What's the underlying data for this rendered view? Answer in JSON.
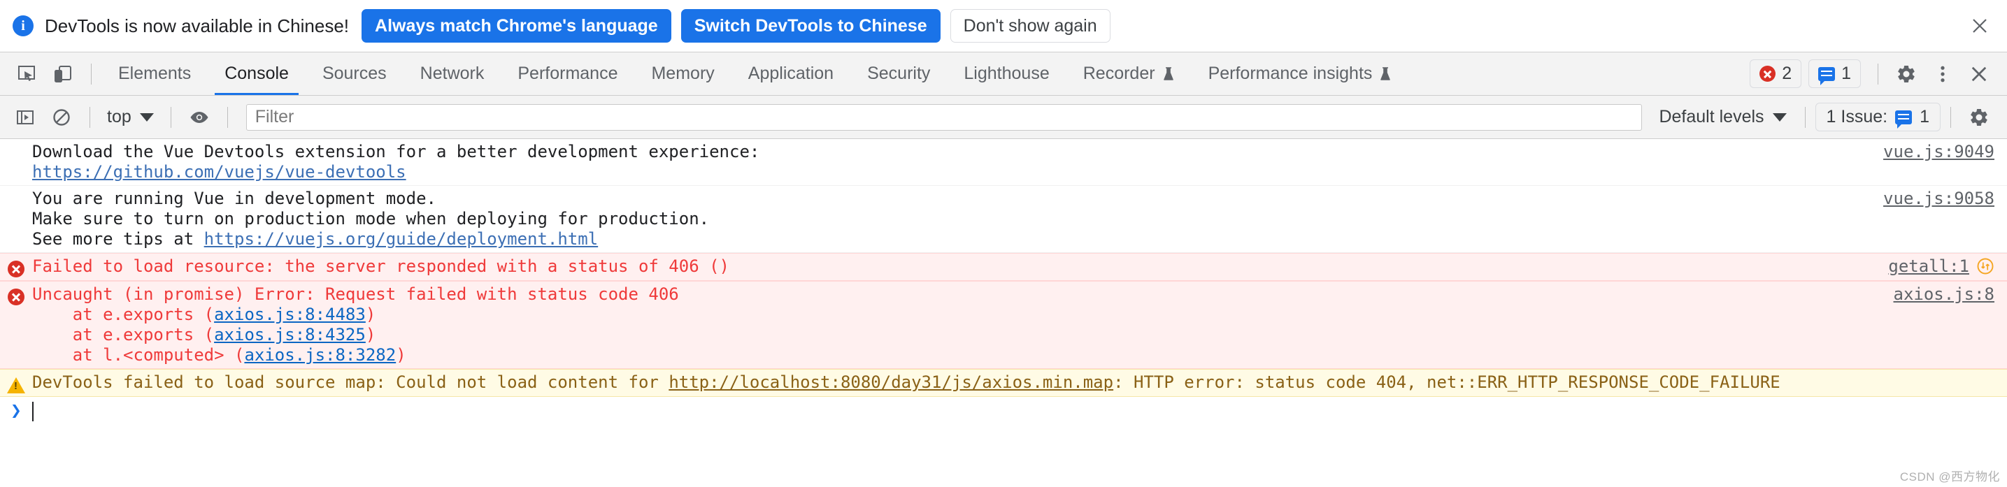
{
  "infobar": {
    "icon": "info-icon",
    "message": "DevTools is now available in Chinese!",
    "primary_button_1": "Always match Chrome's language",
    "primary_button_2": "Switch DevTools to Chinese",
    "secondary_button": "Don't show again",
    "close_icon": "close-icon",
    "accent_color": "#1a73e8"
  },
  "tabstrip": {
    "inspect_icon": "inspect-element-icon",
    "device_icon": "device-toolbar-icon",
    "tabs": [
      {
        "label": "Elements",
        "selected": false,
        "experimental": false
      },
      {
        "label": "Console",
        "selected": true,
        "experimental": false
      },
      {
        "label": "Sources",
        "selected": false,
        "experimental": false
      },
      {
        "label": "Network",
        "selected": false,
        "experimental": false
      },
      {
        "label": "Performance",
        "selected": false,
        "experimental": false
      },
      {
        "label": "Memory",
        "selected": false,
        "experimental": false
      },
      {
        "label": "Application",
        "selected": false,
        "experimental": false
      },
      {
        "label": "Security",
        "selected": false,
        "experimental": false
      },
      {
        "label": "Lighthouse",
        "selected": false,
        "experimental": false
      },
      {
        "label": "Recorder",
        "selected": false,
        "experimental": true
      },
      {
        "label": "Performance insights",
        "selected": false,
        "experimental": true
      }
    ],
    "error_count": "2",
    "message_count": "1",
    "settings_icon": "gear-icon",
    "more_icon": "more-vertical-icon",
    "close_icon": "close-icon",
    "error_color": "#d93025",
    "message_color": "#1a73e8",
    "selected_tab_underline": "#1a73e8"
  },
  "console_toolbar": {
    "sidebar_icon": "console-sidebar-icon",
    "clear_icon": "clear-console-icon",
    "context": "top",
    "eye_icon": "live-expression-eye-icon",
    "filter_placeholder": "Filter",
    "filter_value": "",
    "levels": "Default levels",
    "issues_label": "1 Issue:",
    "issues_count": "1",
    "settings_icon": "gear-icon"
  },
  "console_messages": [
    {
      "level": "info",
      "icon": "none",
      "lines": [
        [
          {
            "t": "Download the Vue Devtools extension for a better development experience:",
            "link": false
          }
        ],
        [
          {
            "t": "https://github.com/vuejs/vue-devtools",
            "link": true
          }
        ]
      ],
      "source": "vue.js:9049",
      "has_issue_icon": false
    },
    {
      "level": "info",
      "icon": "none",
      "lines": [
        [
          {
            "t": "You are running Vue in development mode.",
            "link": false
          }
        ],
        [
          {
            "t": "Make sure to turn on production mode when deploying for production.",
            "link": false
          }
        ],
        [
          {
            "t": "See more tips at ",
            "link": false
          },
          {
            "t": "https://vuejs.org/guide/deployment.html",
            "link": true
          }
        ]
      ],
      "source": "vue.js:9058",
      "has_issue_icon": false
    },
    {
      "level": "error",
      "icon": "error-icon",
      "lines": [
        [
          {
            "t": "Failed to load resource: the server responded with a status of 406 ()",
            "link": false
          }
        ]
      ],
      "source": "getall:1",
      "has_issue_icon": true
    },
    {
      "level": "error",
      "icon": "error-icon",
      "lines": [
        [
          {
            "t": "Uncaught (in promise) Error: Request failed with status code 406",
            "link": false
          }
        ],
        [
          {
            "t": "    at e.exports (",
            "link": false,
            "indent": true
          },
          {
            "t": "axios.js:8:4483",
            "link": true
          },
          {
            "t": ")",
            "link": false
          }
        ],
        [
          {
            "t": "    at e.exports (",
            "link": false,
            "indent": true
          },
          {
            "t": "axios.js:8:4325",
            "link": true
          },
          {
            "t": ")",
            "link": false
          }
        ],
        [
          {
            "t": "    at l.<computed> (",
            "link": false,
            "indent": true
          },
          {
            "t": "axios.js:8:3282",
            "link": true
          },
          {
            "t": ")",
            "link": false
          }
        ]
      ],
      "source": "axios.js:8",
      "has_issue_icon": false
    },
    {
      "level": "warn",
      "icon": "warning-icon",
      "lines": [
        [
          {
            "t": "DevTools failed to load source map: Could not load content for ",
            "link": false
          },
          {
            "t": "http://localhost:8080/day31/js/axios.min.map",
            "link": true
          },
          {
            "t": ": HTTP error: status code 404, net::ERR_HTTP_RESPONSE_CODE_FAILURE",
            "link": false
          }
        ]
      ],
      "source": "",
      "has_issue_icon": false
    }
  ],
  "prompt": {
    "arrow": "chevron-right-icon",
    "value": ""
  },
  "watermark": "CSDN @西方物化"
}
